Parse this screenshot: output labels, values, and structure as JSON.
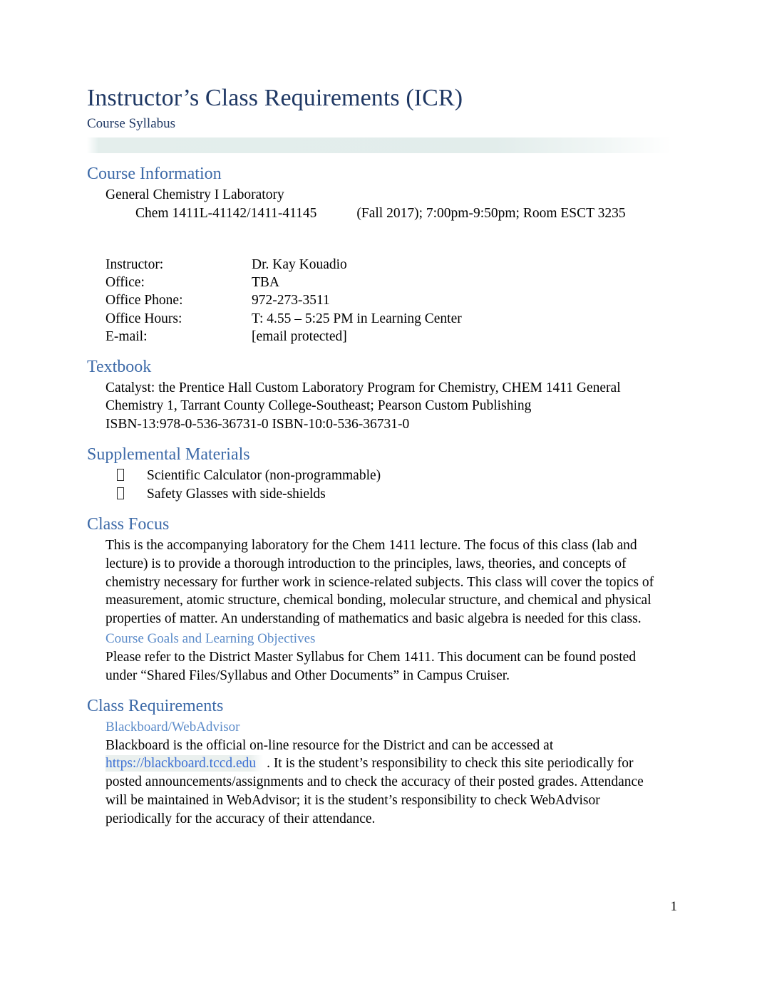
{
  "document": {
    "title": "Instructor’s Class Requirements (ICR)",
    "subtitle": "Course Syllabus",
    "page_number": "1"
  },
  "course_information": {
    "heading": "Course Information",
    "course_name": "General Chemistry I Laboratory",
    "course_code": "Chem 1411L-41142/1411-41145",
    "term_and_schedule": "(Fall 2017);   7:00pm-9:50pm; Room ESCT 3235",
    "details": [
      {
        "label": "Instructor:",
        "value": "Dr. Kay Kouadio"
      },
      {
        "label": "Office:",
        "value": "TBA"
      },
      {
        "label": "Office Phone:",
        "value": "972-273-3511"
      },
      {
        "label": "Office Hours:",
        "value": "T: 4.55 – 5:25 PM in Learning Center"
      },
      {
        "label": "E-mail:",
        "value": "[email protected]"
      }
    ]
  },
  "textbook": {
    "heading": "Textbook",
    "line1": "Catalyst:  the Prentice Hall Custom Laboratory Program for Chemistry, CHEM 1411 General",
    "line2": "Chemistry 1, Tarrant County College-Southeast; Pearson Custom Publishing",
    "line3": "ISBN-13:978-0-536-36731-0  ISBN-10:0-536-36731-0"
  },
  "supplemental_materials": {
    "heading": "Supplemental Materials",
    "items": [
      "Scientific Calculator (non-programmable)",
      "Safety Glasses with side-shields"
    ]
  },
  "class_focus": {
    "heading": "Class Focus",
    "paragraph": "This is the accompanying laboratory for the Chem 1411 lecture.   The focus of this class (lab and lecture) is to provide a thorough introduction to the principles, laws, theories, and concepts of chemistry necessary for further work in science-related subjects.    This class will cover the topics of measurement, atomic structure, chemical bonding, molecular structure, and chemical and physical properties of matter.   An understanding of mathematics and basic algebra is needed for this class.",
    "subheading": "Course Goals and Learning Objectives",
    "sub_paragraph": "Please refer to the District Master Syllabus for Chem 1411.  This document can be found posted under “Shared Files/Syllabus and Other Documents” in Campus Cruiser."
  },
  "class_requirements": {
    "heading": "Class Requirements",
    "subheading": "Blackboard/WebAdvisor",
    "text_before_link": "Blackboard is the official on-line resource for the District and can be accessed at ",
    "link_text": "https://blackboard.tccd.edu",
    "text_after_link": " .  It is the student’s responsibility to check this site periodically for posted announcements/assignments and to check the accuracy of their posted grades. Attendance will be maintained in WebAdvisor; it is the student’s responsibility to check WebAdvisor periodically for the accuracy of their attendance."
  },
  "colors": {
    "title_navy": "#1f3864",
    "heading_blue": "#3d6aa8",
    "subheading_blue": "#5b8bc9",
    "link_blue": "#3b6fd4",
    "band_green": "#dfebe9"
  }
}
